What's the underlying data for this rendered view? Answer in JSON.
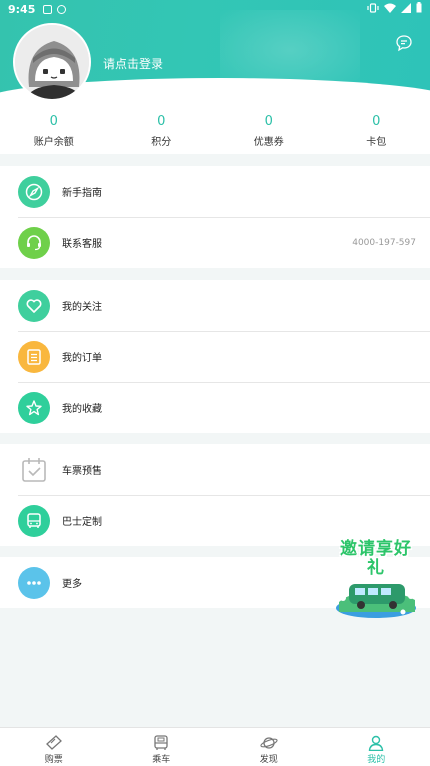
{
  "status_bar": {
    "time": "9:45"
  },
  "header": {
    "login_text": "请点击登录"
  },
  "stats": [
    {
      "value": "0",
      "label": "账户余额"
    },
    {
      "value": "0",
      "label": "积分"
    },
    {
      "value": "0",
      "label": "优惠券"
    },
    {
      "value": "0",
      "label": "卡包"
    }
  ],
  "menu": {
    "guide": {
      "label": "新手指南"
    },
    "service": {
      "label": "联系客服",
      "phone": "4000-197-597"
    },
    "follow": {
      "label": "我的关注"
    },
    "orders": {
      "label": "我的订单"
    },
    "favorites": {
      "label": "我的收藏"
    },
    "presale": {
      "label": "车票预售"
    },
    "bus_custom": {
      "label": "巴士定制"
    },
    "more": {
      "label": "更多"
    }
  },
  "promo": {
    "text": "邀请享好礼"
  },
  "tabbar": [
    {
      "label": "购票"
    },
    {
      "label": "乘车"
    },
    {
      "label": "发现"
    },
    {
      "label": "我的"
    }
  ],
  "colors": {
    "accent": "#2cc0a8",
    "guide": "#3fcf9d",
    "service": "#6fd04a",
    "follow": "#3fcf9d",
    "orders": "#f9b73e",
    "favorites": "#2fcf9b",
    "bus_custom": "#2fcf9b",
    "more": "#5bc3ea"
  }
}
